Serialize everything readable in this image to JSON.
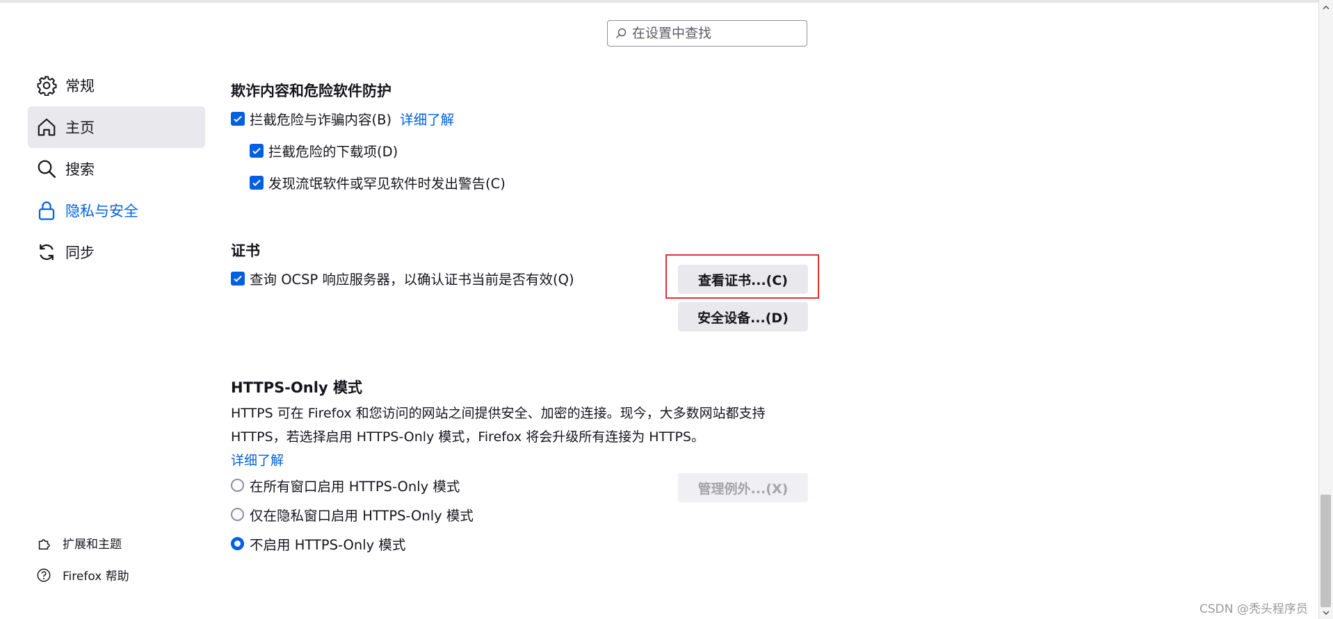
{
  "search": {
    "placeholder": "在设置中查找"
  },
  "sidebar": {
    "items": [
      {
        "label": "常规",
        "icon": "gear-icon"
      },
      {
        "label": "主页",
        "icon": "home-icon"
      },
      {
        "label": "搜索",
        "icon": "search-icon"
      },
      {
        "label": "隐私与安全",
        "icon": "lock-icon"
      },
      {
        "label": "同步",
        "icon": "sync-icon"
      }
    ],
    "selected_index": 1,
    "active_index": 3,
    "footer": [
      {
        "label": "扩展和主题",
        "icon": "puzzle-icon"
      },
      {
        "label": "Firefox 帮助",
        "icon": "help-icon"
      }
    ]
  },
  "deceptive": {
    "heading": "欺诈内容和危险软件防护",
    "block_dangerous": {
      "label": "拦截危险与诈骗内容(B)",
      "checked": true
    },
    "learn_more": "详细了解",
    "block_downloads": {
      "label": "拦截危险的下载项(D)",
      "checked": true
    },
    "warn_unwanted": {
      "label": "发现流氓软件或罕见软件时发出警告(C)",
      "checked": true
    }
  },
  "certificates": {
    "heading": "证书",
    "ocsp": {
      "label": "查询 OCSP 响应服务器，以确认证书当前是否有效(Q)",
      "checked": true
    },
    "view_button": "查看证书...(C)",
    "security_devices_button": "安全设备...(D)"
  },
  "https_only": {
    "heading": "HTTPS-Only 模式",
    "description_line1": "HTTPS 可在 Firefox 和您访问的网站之间提供安全、加密的连接。现今，大多数网站都支持",
    "description_line2": "HTTPS，若选择启用 HTTPS-Only 模式，Firefox 将会升级所有连接为 HTTPS。",
    "learn_more": "详细了解",
    "manage_exceptions_button": "管理例外...(X)",
    "options": [
      {
        "label": "在所有窗口启用 HTTPS-Only 模式",
        "selected": false
      },
      {
        "label": "仅在隐私窗口启用 HTTPS-Only 模式",
        "selected": false
      },
      {
        "label": "不启用 HTTPS-Only 模式",
        "selected": true
      }
    ]
  },
  "watermark": "CSDN @秃头程序员",
  "colors": {
    "accent": "#0061e0",
    "highlight": "#e52e2e",
    "selected_bg": "#e9e9ed"
  }
}
